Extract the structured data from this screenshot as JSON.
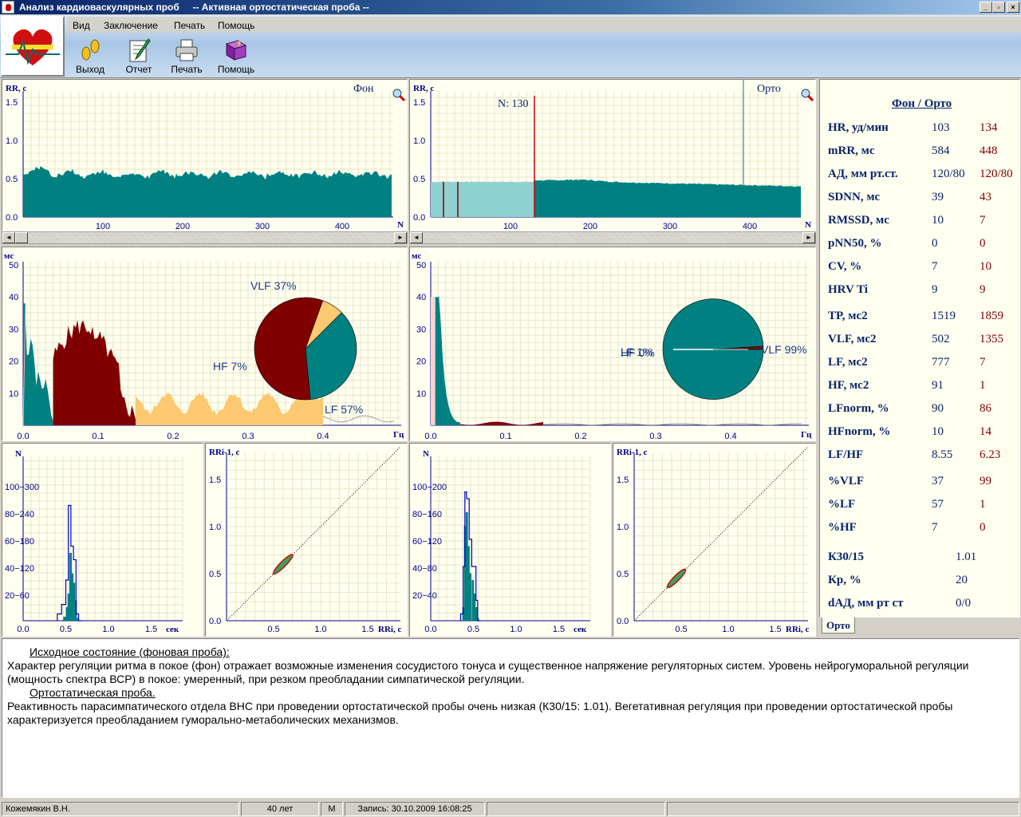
{
  "window": {
    "title": "Анализ кардиоваскулярных проб     -- Активная ортостатическая проба --",
    "controls": [
      "_",
      "▫",
      "×"
    ]
  },
  "menu": [
    "Вид",
    "Заключение",
    "Печать",
    "Помощь"
  ],
  "toolbar": {
    "exit": "Выход",
    "report": "Отчет",
    "print": "Печать",
    "help": "Помощь"
  },
  "colors": {
    "teal": "#008080",
    "lightTeal": "#8fd0d0",
    "maroon": "#800000",
    "yellow": "#fcc870",
    "axisBlue": "#00008b",
    "red": "#c00000"
  },
  "rr": {
    "left": {
      "ylabel": "RR, с",
      "tag": "Фон",
      "yticks": [
        "1.5",
        "1.0",
        "0.5",
        "0.0"
      ],
      "xticks": [
        "100",
        "200",
        "300",
        "400"
      ],
      "xunit": "N",
      "mean": 0.56
    },
    "right": {
      "ylabel": "RR, с",
      "tag": "Орто",
      "marker": "N: 130",
      "yticks": [
        "1.5",
        "1.0",
        "0.5",
        "0.0"
      ],
      "xticks": [
        "100",
        "200",
        "300",
        "400"
      ],
      "xunit": "N"
    }
  },
  "spectrum": {
    "left": {
      "ylabel": "мс",
      "yticks": [
        "50",
        "40",
        "30",
        "20",
        "10"
      ],
      "xticks": [
        "0.0",
        "0.1",
        "0.2",
        "0.3",
        "0.4"
      ],
      "xunit": "Гц",
      "vlf_label": "VLF 37%",
      "lf_label": "LF 57%",
      "hf_label": "HF  7%"
    },
    "right": {
      "ylabel": "мс",
      "yticks": [
        "50",
        "40",
        "30",
        "20",
        "10"
      ],
      "xticks": [
        "0.0",
        "0.1",
        "0.2",
        "0.3",
        "0.4"
      ],
      "xunit": "Гц",
      "vlf_label": "VLF 99%",
      "lf_label": "LF  1%",
      "hf_label": "HF  0%"
    }
  },
  "hist": {
    "left": {
      "ylabel": "N",
      "yticks": [
        "100−300",
        "80−240",
        "60−180",
        "40−120",
        "20−60"
      ],
      "xticks": [
        "0.0",
        "0.5",
        "1.0",
        "1.5"
      ],
      "xunit": "сек"
    },
    "right": {
      "ylabel": "N",
      "yticks": [
        "100−200",
        "80−160",
        "60−120",
        "40−80",
        "20−40"
      ],
      "xticks": [
        "0.0",
        "0.5",
        "1.0",
        "1.5"
      ],
      "xunit": "сек"
    }
  },
  "scatter": {
    "left": {
      "ylabel": "RRi-1, с",
      "yticks": [
        "1.5",
        "1.0",
        "0.5",
        "0.0"
      ],
      "xticks": [
        "0.5",
        "1.0",
        "1.5"
      ],
      "xunit": "RRi, с"
    },
    "right": {
      "ylabel": "RRi-1, с",
      "yticks": [
        "1.5",
        "1.0",
        "0.5",
        "0.0"
      ],
      "xticks": [
        "0.5",
        "1.0",
        "1.5"
      ],
      "xunit": "RRi, с"
    }
  },
  "stats": {
    "header": "Фон / Орто",
    "rows": [
      {
        "k": "HR, уд/мин",
        "a": "103",
        "b": "134"
      },
      {
        "k": "mRR, мс",
        "a": "584",
        "b": "448"
      },
      {
        "k": "АД, мм рт.ст.",
        "a": "120/80",
        "b": "120/80"
      },
      {
        "k": "SDNN, мс",
        "a": "39",
        "b": "43"
      },
      {
        "k": "RMSSD, мс",
        "a": "10",
        "b": "7"
      },
      {
        "k": "pNN50, %",
        "a": "0",
        "b": "0"
      },
      {
        "k": "CV, %",
        "a": "7",
        "b": "10"
      },
      {
        "k": "HRV Ti",
        "a": "9",
        "b": "9"
      },
      {
        "k": "TP, мс2",
        "a": "1519",
        "b": "1859"
      },
      {
        "k": "VLF, мс2",
        "a": "502",
        "b": "1355"
      },
      {
        "k": "LF, мс2",
        "a": "777",
        "b": "7"
      },
      {
        "k": "HF, мс2",
        "a": "91",
        "b": "1"
      },
      {
        "k": "LFnorm, %",
        "a": "90",
        "b": "86"
      },
      {
        "k": "HFnorm, %",
        "a": "10",
        "b": "14"
      },
      {
        "k": "LF/HF",
        "a": "8.55",
        "b": "6.23"
      },
      {
        "k": "%VLF",
        "a": "37",
        "b": "99"
      },
      {
        "k": "%LF",
        "a": "57",
        "b": "1"
      },
      {
        "k": "%HF",
        "a": "7",
        "b": "0"
      },
      {
        "k": "К30/15",
        "v": "1.01"
      },
      {
        "k": "Кр, %",
        "v": "20"
      },
      {
        "k": "dАД, мм рт ст",
        "v": "0/0"
      }
    ],
    "tab": "Орто"
  },
  "report": {
    "h1": "Исходное состояние (фоновая проба):",
    "p1": "Характер регуляции ритма в покое (фон) отражает возможные изменения сосудистого тонуса и существенное напряжение регуляторных систем. Уровень нейрогуморальной регуляции (мощность спектра ВСР) в покое: умеренный, при резком преобладании симпатической регуляции.",
    "h2": "Ортостатическая проба.",
    "p2": "Реактивность парасимпатического отдела ВНС при проведении ортостатической пробы очень низкая (К30/15: 1.01).  Вегетативная регуляция при проведении ортостатической пробы характеризуется преобладанием гуморально-метаболических механизмов."
  },
  "status": {
    "name": "Кожемякин В.Н.",
    "age": "40 лет",
    "sex": "М",
    "record": "Запись: 30.10.2009 16:08:25"
  }
}
